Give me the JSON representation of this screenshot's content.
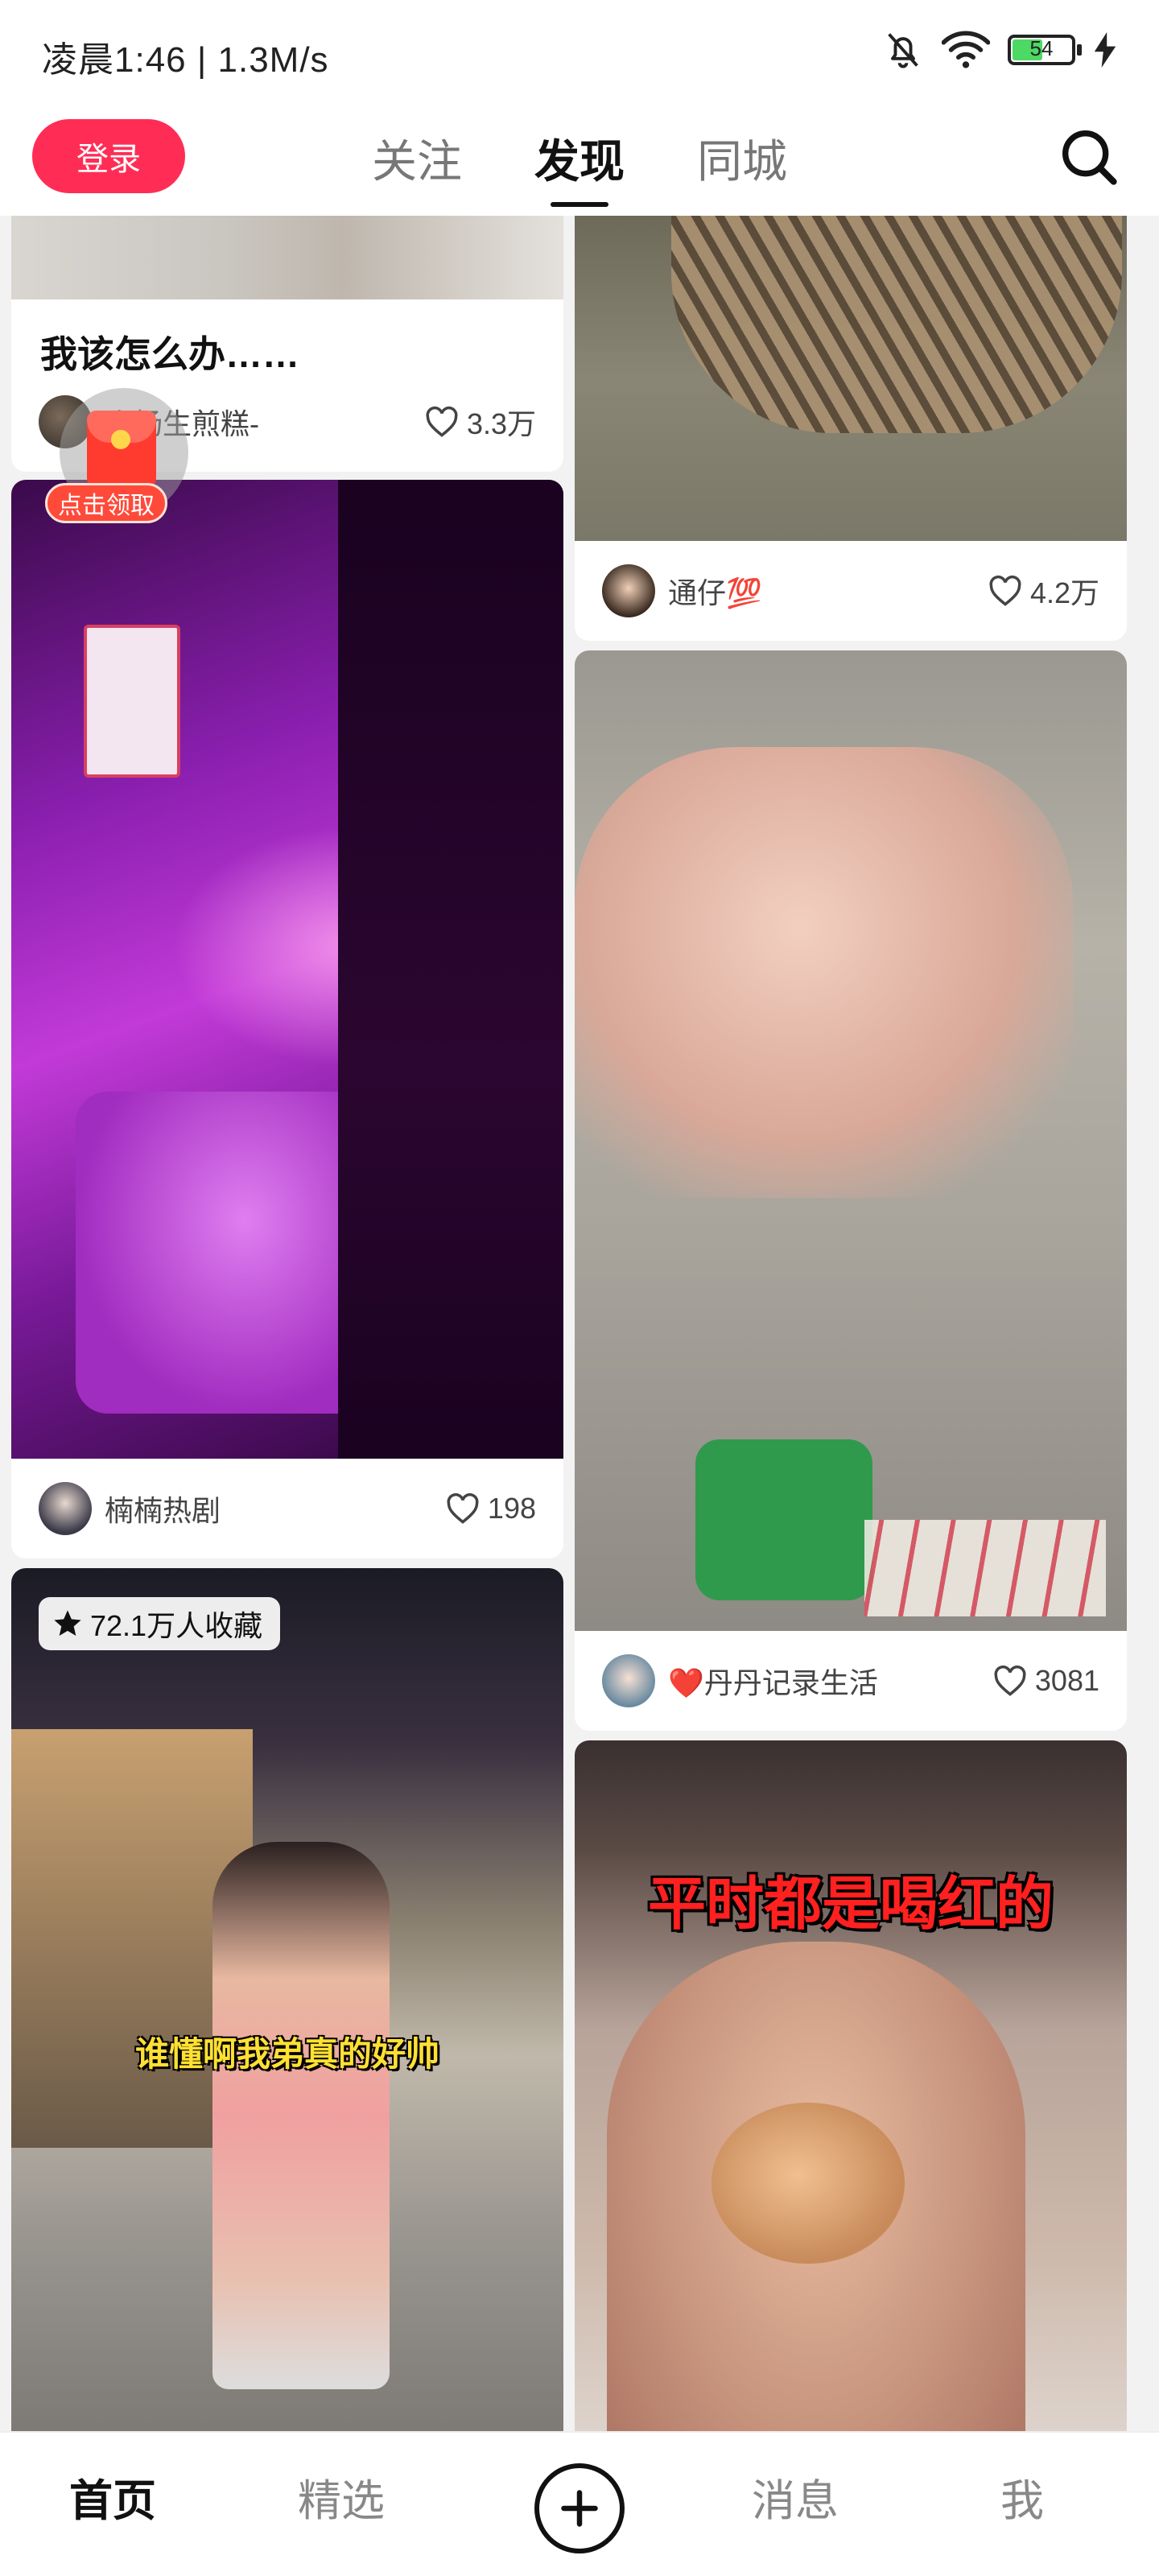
{
  "status": {
    "time": "凌晨1:46 | 1.3M/s",
    "battery": "54",
    "battery_level": 0.54
  },
  "header": {
    "login_label": "登录",
    "tabs": [
      {
        "label": "关注"
      },
      {
        "label": "发现"
      },
      {
        "label": "同城"
      }
    ],
    "active_tab": "发现"
  },
  "feed": {
    "left": [
      {
        "title": "我该怎么办……",
        "author": "小杨生煎糕-",
        "likes": "3.3万"
      },
      {
        "author": "楠楠热剧",
        "likes": "198"
      },
      {
        "badge": "72.1万人收藏",
        "caption": "谁懂啊我弟真的好帅"
      }
    ],
    "right": [
      {
        "author": "通仔💯",
        "likes": "4.2万"
      },
      {
        "author": "❤️丹丹记录生活",
        "likes": "3081"
      },
      {
        "caption": "平时都是喝红的"
      }
    ]
  },
  "redpacket": {
    "label": "点击领取"
  },
  "bottom_nav": {
    "items": [
      {
        "label": "首页"
      },
      {
        "label": "精选"
      },
      {
        "label": "消息"
      },
      {
        "label": "我"
      }
    ]
  },
  "colors": {
    "accent": "#ff2d55",
    "background": "#f2f2f2"
  }
}
